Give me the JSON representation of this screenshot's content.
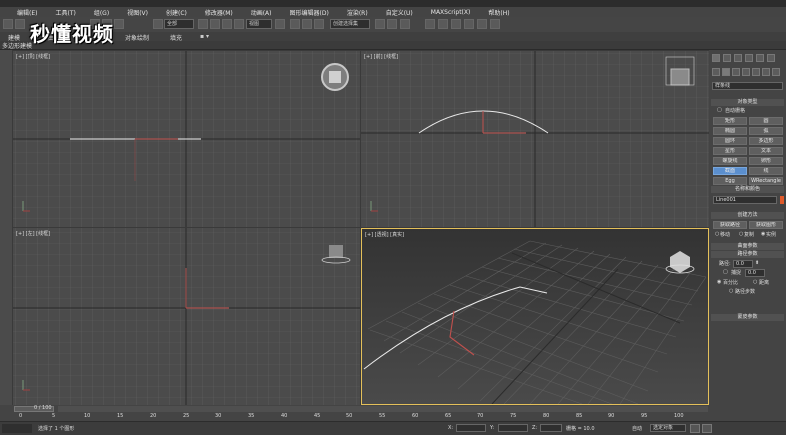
{
  "menu": [
    "编辑(E)",
    "工具(T)",
    "组(G)",
    "视图(V)",
    "创建(C)",
    "修改器(M)",
    "动画(A)",
    "图形编辑器(D)",
    "渲染(R)",
    "自定义(U)",
    "MAXScript(X)",
    "帮助(H)"
  ],
  "toolbar": {
    "filter_value": "全部",
    "view_value": "视图",
    "selection_set": "创建选择集"
  },
  "ribbon": {
    "tabs": [
      "建模",
      "自由形式",
      "选择",
      "对象绘制",
      "填充"
    ],
    "sub_label": "多边形建模"
  },
  "watermark": "秒懂视频",
  "viewports": {
    "top": "[+] [顶] [线框]",
    "front": "[+] [前] [线框]",
    "left": "[+] [左] [线框]",
    "persp": "[+] [透视] [真实]"
  },
  "command_panel": {
    "category": "样条线",
    "object_type_header": "对象类型",
    "autogrid": "自动栅格",
    "buttons": [
      [
        "矩形",
        "圆"
      ],
      [
        "椭圆",
        "弧"
      ],
      [
        "圆环",
        "多边形"
      ],
      [
        "星形",
        "文本"
      ],
      [
        "螺旋线",
        "卵形"
      ],
      [
        "截面",
        "线"
      ],
      [
        "Egg",
        "WRectangle"
      ]
    ],
    "name_color_header": "名称和颜色",
    "object_name": "Line001",
    "creation_method_header": "创建方法",
    "creation_buttons": [
      "移动",
      "复制",
      "实例"
    ],
    "get_path": "获取路径",
    "get_shape": "获取图形",
    "surface_params_header": "曲面参数",
    "path_params_header": "路径参数",
    "path_label": "路径:",
    "path_value": "0.0",
    "snap_label": "捕捉",
    "percent_label": "百分比",
    "distance_label": "距离",
    "path_steps_label": "路径步数",
    "skin_params_header": "蒙皮参数"
  },
  "timeline": {
    "frame_counter": "0 / 100",
    "ticks": [
      "0",
      "5",
      "10",
      "15",
      "20",
      "25",
      "30",
      "35",
      "40",
      "45",
      "50",
      "55",
      "60",
      "65",
      "70",
      "75",
      "80",
      "85",
      "90",
      "95",
      "100"
    ]
  },
  "status": {
    "message": "选择了 1 个图形",
    "x_label": "X:",
    "y_label": "Y:",
    "z_label": "Z:",
    "grid": "栅格 = 10.0",
    "auto_key": "自动",
    "set_key": "选定对象",
    "key_filter": "设置关键点"
  }
}
